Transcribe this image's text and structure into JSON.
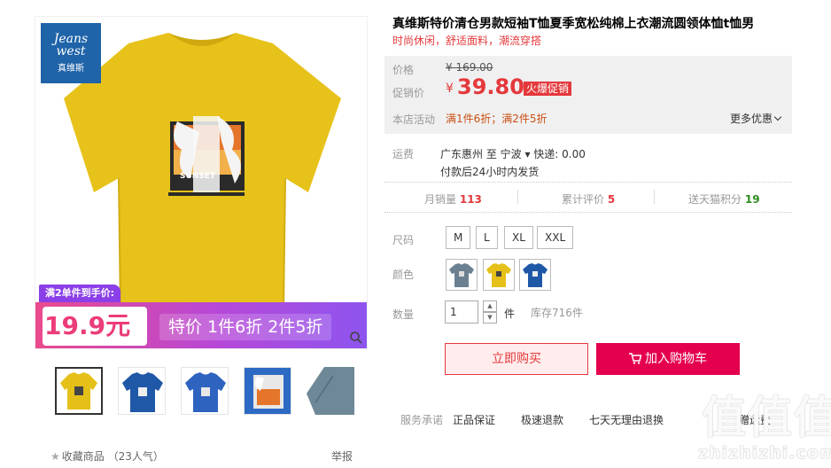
{
  "brand": {
    "line1": "Jeans",
    "line2": "west",
    "line3": "真维斯",
    "color": "#1f63a8"
  },
  "promo_overlay": {
    "tag": "满2单件到手价:",
    "price": "19.9元",
    "text": "特价 1件6折 2件5折",
    "gradient": [
      "#ea4a8c",
      "#8d55ef"
    ]
  },
  "thumbnails": [
    {
      "name": "yellow-front",
      "color": "#e5c019"
    },
    {
      "name": "blue-front",
      "color": "#2058a8"
    },
    {
      "name": "blue-front-2",
      "color": "#2e64c0"
    },
    {
      "name": "print-detail",
      "color": "#2d6ac4"
    },
    {
      "name": "grey-detail",
      "color": "#6f8898"
    }
  ],
  "favorite": {
    "label": "收藏商品",
    "count": "（23人气）"
  },
  "report": "举报",
  "product": {
    "title": "真维斯特价清仓男款短袖T恤夏季宽松纯棉上衣潮流圆领体恤t恤男",
    "subtitle": "时尚休闲，舒适面料，潮流穿搭"
  },
  "pricing": {
    "price_label": "价格",
    "original_price": "¥ 169.00",
    "promo_label": "促销价",
    "yen": "¥",
    "promo_price": "39.80",
    "hot_badge": "火爆促销",
    "activity_label": "本店活动",
    "activity_text": "满1件6折；满2件5折",
    "more_offers": "更多优惠"
  },
  "shipping": {
    "label": "运费",
    "route": "广东惠州 至 宁波 ▾ 快递: 0.00",
    "note": "付款后24小时内发货"
  },
  "stats": {
    "monthly_sales_label": "月销量",
    "monthly_sales": "113",
    "reviews_label": "累计评价",
    "reviews": "5",
    "points_label": "送天猫积分",
    "points": "19"
  },
  "size": {
    "label": "尺码",
    "options": [
      "M",
      "L",
      "XL",
      "XXL"
    ]
  },
  "color": {
    "label": "颜色",
    "options": [
      {
        "name": "grey",
        "color": "#6b8192"
      },
      {
        "name": "yellow",
        "color": "#e5c019"
      },
      {
        "name": "blue",
        "color": "#2058a8"
      }
    ]
  },
  "quantity": {
    "label": "数量",
    "value": "1",
    "unit": "件",
    "stock": "库存716件"
  },
  "actions": {
    "buy_now": "立即购买",
    "add_to_cart": "加入购物车"
  },
  "services": {
    "label": "服务承诺",
    "items": [
      "正品保证",
      "极速退款",
      "七天无理由退换",
      "赠运费"
    ]
  },
  "watermark": {
    "big": "值值值",
    "small": "zhizhizhi.com"
  }
}
